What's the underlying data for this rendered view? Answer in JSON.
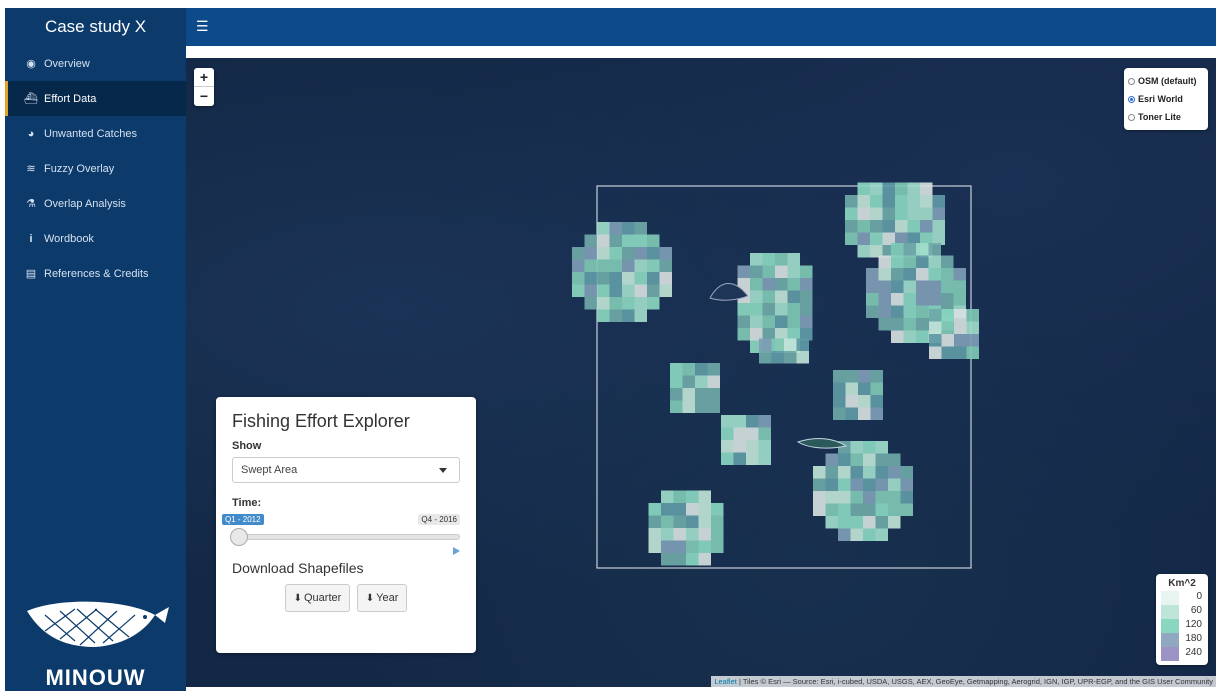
{
  "sidebar": {
    "brand": "Case study X",
    "items": [
      {
        "label": "Overview",
        "icon": "dashboard-icon"
      },
      {
        "label": "Effort Data",
        "icon": "ship-icon"
      },
      {
        "label": "Unwanted Catches",
        "icon": "pie-chart-icon"
      },
      {
        "label": "Fuzzy Overlay",
        "icon": "layers-icon"
      },
      {
        "label": "Overlap Analysis",
        "icon": "flask-icon"
      },
      {
        "label": "Wordbook",
        "icon": "info-icon"
      },
      {
        "label": "References & Credits",
        "icon": "book-icon"
      }
    ],
    "active_index": 1,
    "logo_text": "MINOUW"
  },
  "map": {
    "layers": [
      {
        "label": "OSM (default)",
        "selected": false
      },
      {
        "label": "Esri World",
        "selected": true
      },
      {
        "label": "Toner Lite",
        "selected": false
      }
    ],
    "legend": {
      "title": "Km^2",
      "values": [
        "0",
        "60",
        "120",
        "180",
        "240"
      ],
      "colors": [
        "#e8f4f0",
        "#bde6d8",
        "#8ad6c0",
        "#8fa8bf",
        "#9b93c4"
      ]
    },
    "attribution": {
      "link": "Leaflet",
      "text": " | Tiles © Esri — Source: Esri, i-cubed, USDA, USGS, AEX, GeoEye, Getmapping, Aerogrid, IGN, IGP, UPR-EGP, and the GIS User Community"
    }
  },
  "panel": {
    "title": "Fishing Effort Explorer",
    "show_label": "Show",
    "show_value": "Swept Area",
    "time_label": "Time:",
    "time_from": "Q1 - 2012",
    "time_to": "Q4 - 2016",
    "download_title": "Download Shapefiles",
    "btn_quarter": "Quarter",
    "btn_year": "Year"
  }
}
